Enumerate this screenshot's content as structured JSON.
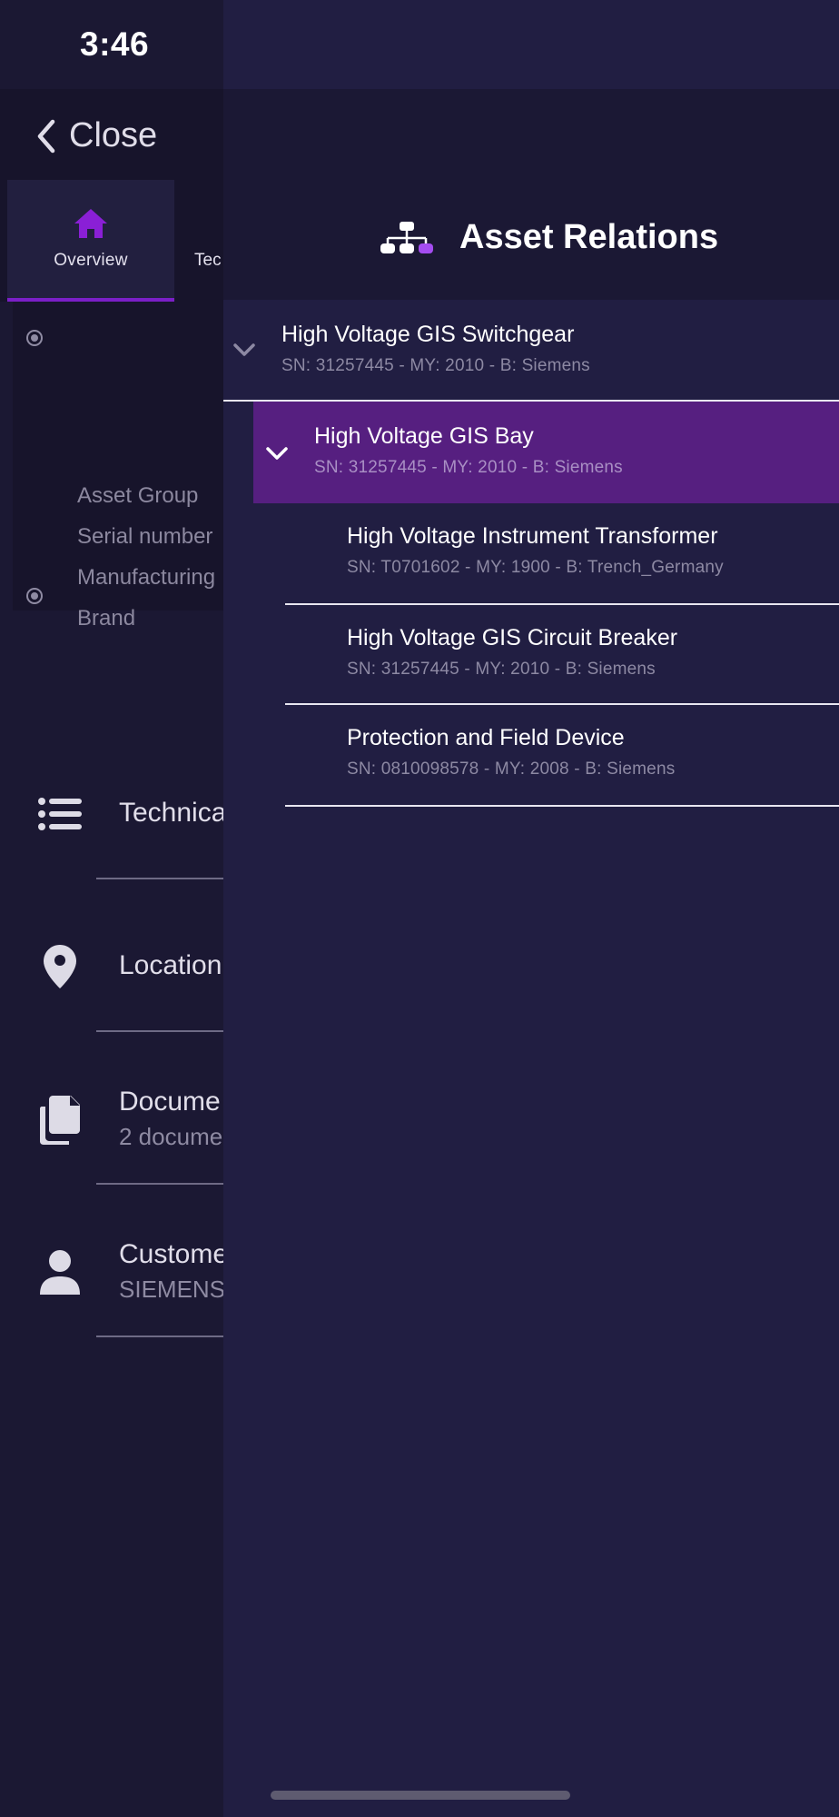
{
  "status_bar": {
    "time": "3:46"
  },
  "left_page": {
    "close_label": "Close",
    "tabs": [
      {
        "label": "Overview",
        "active": true
      },
      {
        "label": "Tec",
        "active": false
      }
    ],
    "info_labels": [
      "Asset Group",
      "Serial number",
      "Manufacturing",
      "Brand"
    ],
    "nav_items": [
      {
        "title": "Technica",
        "subtitle": "",
        "icon": "list-icon"
      },
      {
        "title": "Location",
        "subtitle": "",
        "icon": "location-pin-icon"
      },
      {
        "title": "Docume",
        "subtitle": "2 docume",
        "icon": "documents-icon"
      },
      {
        "title": "Custome",
        "subtitle": "SIEMENS",
        "icon": "person-icon"
      }
    ]
  },
  "drawer": {
    "title": "Asset Relations",
    "icon": "hierarchy-icon",
    "tree": [
      {
        "title": "High Voltage GIS Switchgear",
        "subtitle": "SN: 31257445 - MY: 2010 - B: Siemens",
        "level": 0,
        "expanded": true,
        "selected": false
      },
      {
        "title": "High Voltage GIS Bay",
        "subtitle": "SN: 31257445 - MY: 2010 - B: Siemens",
        "level": 1,
        "expanded": true,
        "selected": true
      },
      {
        "title": "High Voltage Instrument Transformer",
        "subtitle": "SN: T0701602 - MY: 1900 - B: Trench_Germany",
        "level": 2,
        "expanded": false,
        "selected": false
      },
      {
        "title": "High Voltage GIS Circuit Breaker",
        "subtitle": "SN: 31257445 - MY: 2010 - B: Siemens",
        "level": 2,
        "expanded": false,
        "selected": false
      },
      {
        "title": "Protection and Field Device",
        "subtitle": "SN: 0810098578 - MY: 2008 - B: Siemens",
        "level": 2,
        "expanded": false,
        "selected": false
      }
    ]
  },
  "colors": {
    "accent_purple": "#7b1fc7",
    "selected_row": "#561f80",
    "drawer_bg": "#211e42",
    "page_bg": "#1b1833"
  }
}
